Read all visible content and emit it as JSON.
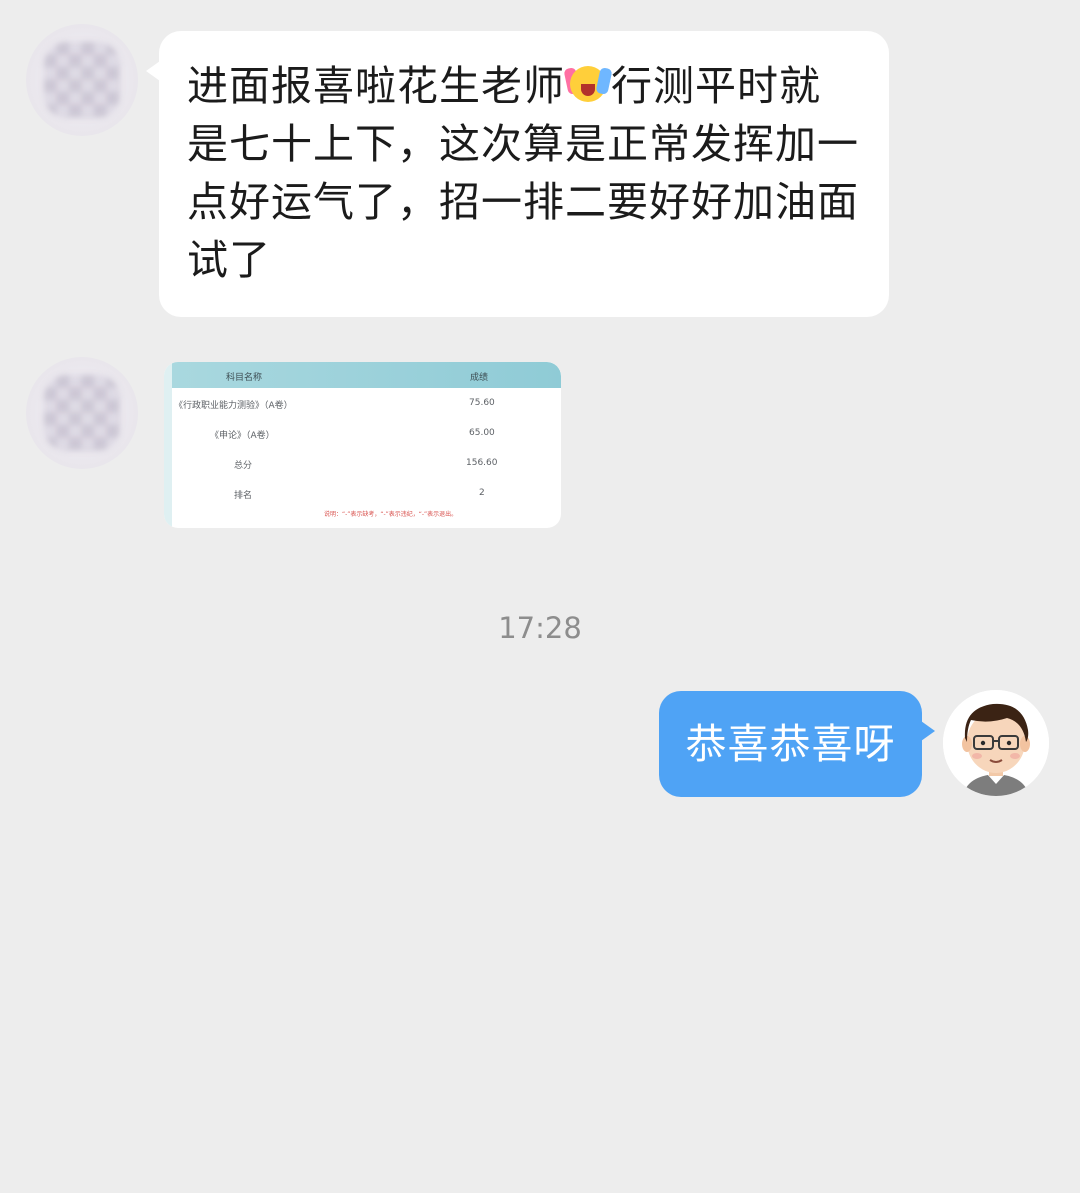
{
  "messages": {
    "incoming_text": {
      "before_emoji": "进面报喜啦花生老师",
      "emoji": "celebration-emoji",
      "after_emoji": "行测平时就是七十上下，这次算是正常发挥加一点好运气了，招一排二要好好加油面试了"
    },
    "score_image": {
      "header": {
        "subject": "科目名称",
        "score": "成绩"
      },
      "rows": [
        {
          "subject": "《行政职业能力测验》（A卷）",
          "score": "75.60"
        },
        {
          "subject": "《申论》（A卷）",
          "score": "65.00"
        },
        {
          "subject": "总分",
          "score": "156.60"
        },
        {
          "subject": "排名",
          "score": "2"
        }
      ],
      "note": "说明：“-”表示缺考，“-”表示违纪，“-”表示退出。"
    },
    "timestamp": "17:28",
    "outgoing_text": "恭喜恭喜呀"
  },
  "colors": {
    "background": "#ededed",
    "incoming_bubble": "#ffffff",
    "outgoing_bubble": "#4fa3f5",
    "table_header": "#a9d8df"
  }
}
